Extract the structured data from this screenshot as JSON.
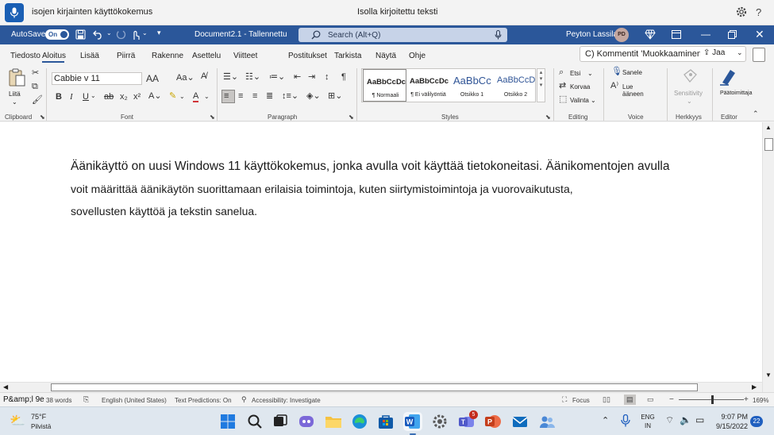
{
  "voice_access": {
    "command_text": "isojen kirjainten käyttökokemus",
    "status_text": "Isolla kirjoitettu teksti",
    "help": "?"
  },
  "titlebar": {
    "autosave_label": "AutoSave",
    "autosave_state": "On",
    "document_title": "Document2.1 - Tallennettu",
    "search_placeholder": "Search (Alt+Q)",
    "user_name": "Peyton Lassila",
    "user_initials": "PD"
  },
  "ribbon_tabs": [
    "Tiedosto",
    "Aloitus",
    "Lisää",
    "Piirrä",
    "Rakenne",
    "Asettelu",
    "Viitteet",
    "Postitukset",
    "Tarkista",
    "Näytä",
    "Ohje"
  ],
  "active_tab": "Aloitus",
  "comments_button": "C) Kommentit 'Muokkaaminen",
  "share_button": "Jaa",
  "ribbon": {
    "clipboard": {
      "paste_label": "Liitä",
      "group_label": "Clipboard"
    },
    "font": {
      "font_name": "Cabbie v 11",
      "group_label": "Font"
    },
    "paragraph": {
      "group_label": "Paragraph"
    },
    "styles": {
      "group_label": "Styles",
      "items": [
        {
          "preview": "AaBbCcDc",
          "name": "¶ Normaali"
        },
        {
          "preview": "AaBbCcDc",
          "name": "¶ Ei välilyöntiä"
        },
        {
          "preview": "AaBbCc",
          "name": "Otsikko 1"
        },
        {
          "preview": "AaBbCcD",
          "name": "Otsikko 2"
        }
      ]
    },
    "editing": {
      "find": "Etsi",
      "replace": "Korvaa",
      "select": "Valinta",
      "group_label": "Editing"
    },
    "voice": {
      "dictate": "Sanele",
      "read_aloud": "Lue ääneen",
      "group_label": "Voice"
    },
    "sensitivity": {
      "button": "Sensitivity",
      "group_label": "Herkkyys"
    },
    "editor": {
      "button": "Päätoimittaja",
      "group_label": "Editor"
    }
  },
  "document": {
    "lines": [
      "Äänikäyttö on uusi Windows 11 käyttökokemus, jonka avulla voit käyttää tietokoneitasi. Äänikomentojen avulla",
      "voit määrittää äänikäytön suorittamaan erilaisia toimintoja, kuten siirtymistoimintoja ja vuorovaikutusta,",
      "sovellusten käyttöä ja tekstin sanelua."
    ]
  },
  "statusbar": {
    "page_overlay": "P&amp;l 9e",
    "word_count": "38 words",
    "language": "English (United States)",
    "text_predictions": "Text Predictions: On",
    "accessibility": "Accessibility: Investigate",
    "focus": "Focus",
    "zoom": "169%"
  },
  "taskbar": {
    "weather_temp": "75°F",
    "weather_desc": "Pilvistä",
    "lang_line1": "ENG",
    "lang_line2": "IN",
    "time": "9:07 PM",
    "date": "9/15/2022",
    "notification_count": "22",
    "teams_badge": "5"
  },
  "colors": {
    "word_blue": "#2b579a",
    "accent": "#1a5fb4"
  }
}
